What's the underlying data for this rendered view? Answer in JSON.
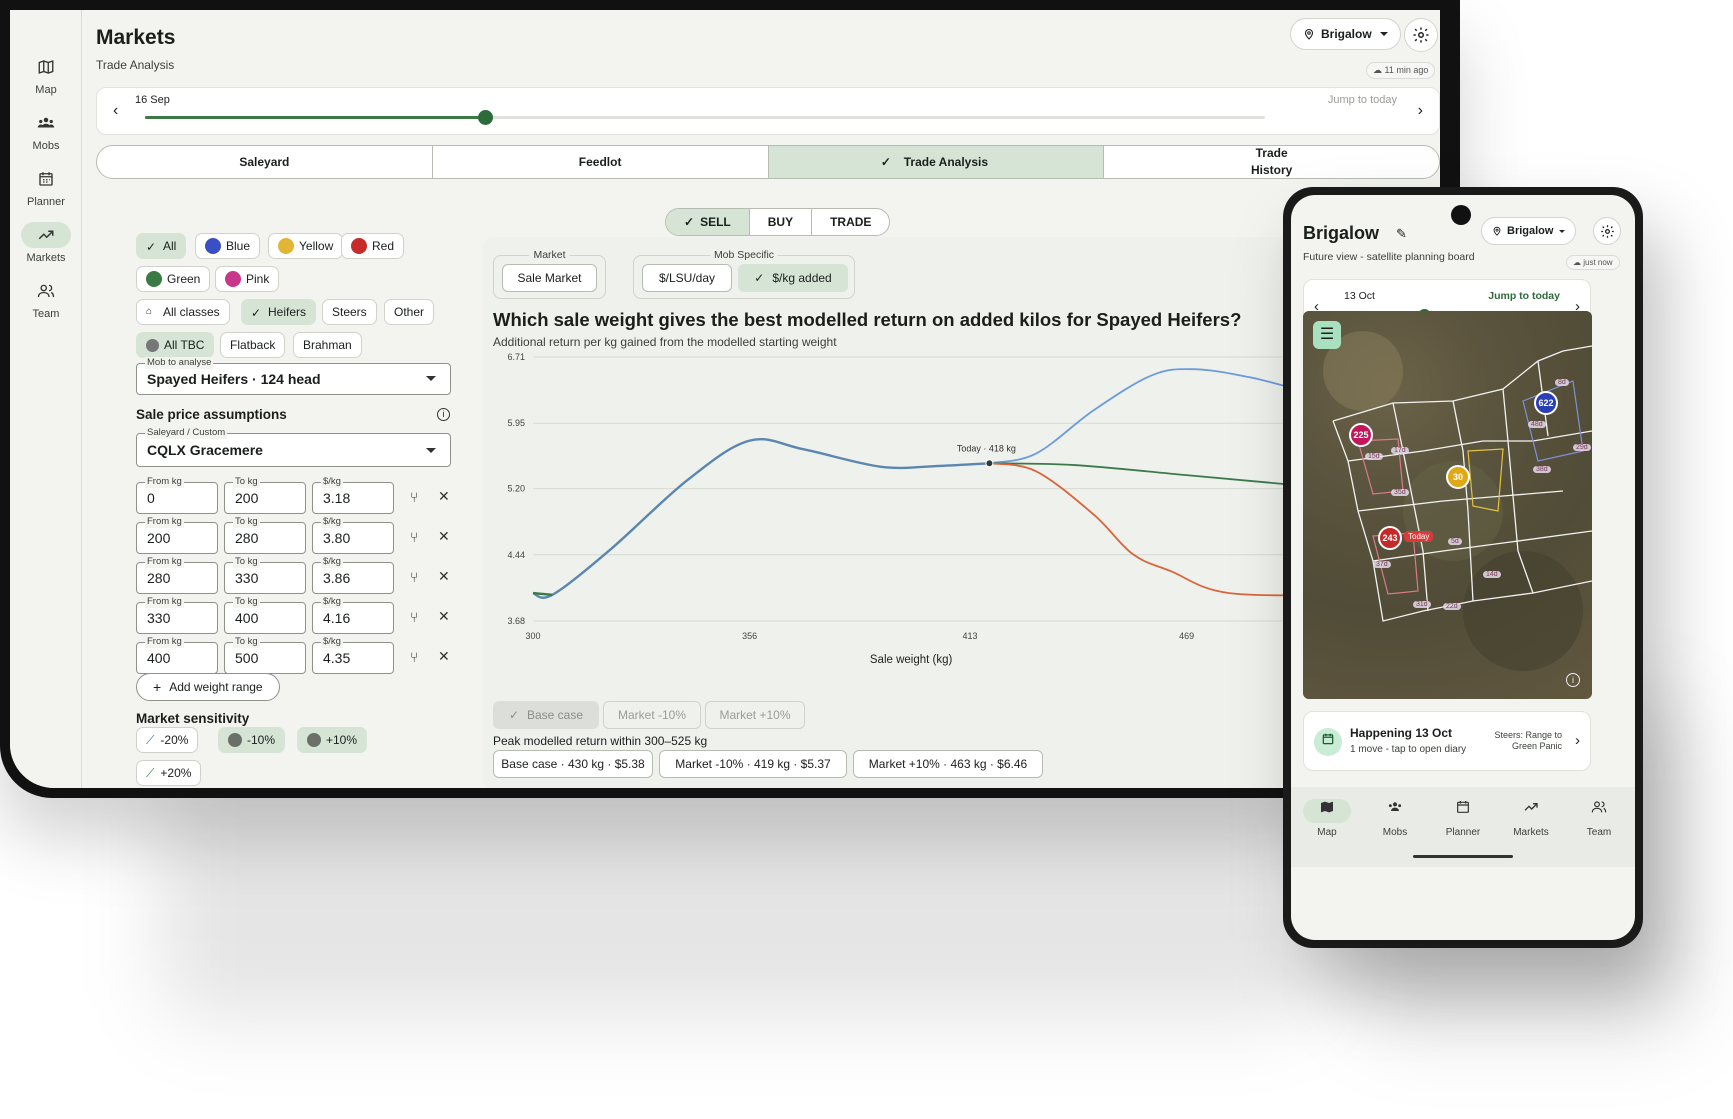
{
  "tablet": {
    "nav_rail": [
      {
        "label": "Map",
        "icon": "map-icon"
      },
      {
        "label": "Mobs",
        "icon": "mobs-icon"
      },
      {
        "label": "Planner",
        "icon": "calendar-icon"
      },
      {
        "label": "Markets",
        "icon": "trending-up-icon",
        "active": true
      },
      {
        "label": "Team",
        "icon": "team-icon"
      }
    ],
    "header": {
      "title": "Markets",
      "subtitle": "Trade Analysis",
      "property": "Brigalow",
      "sync": "11 min ago"
    },
    "timeline": {
      "date": "16 Sep",
      "jump": "Jump to today",
      "position": 0.304
    },
    "tabs": [
      {
        "label": "Saleyard",
        "active": false
      },
      {
        "label": "Feedlot",
        "active": false
      },
      {
        "label": "Trade Analysis",
        "active": true
      },
      {
        "label": "Trade History",
        "active": false
      }
    ],
    "mode": [
      "SELL",
      "BUY",
      "TRADE"
    ],
    "mode_active": "SELL",
    "color_chips": [
      {
        "label": "All",
        "on": true
      },
      {
        "label": "Blue",
        "color": "#3b4fc4"
      },
      {
        "label": "Yellow",
        "color": "#e2b534"
      },
      {
        "label": "Red",
        "color": "#c62a2a"
      },
      {
        "label": "Green",
        "color": "#3c7a45"
      },
      {
        "label": "Pink",
        "color": "#c9378a"
      }
    ],
    "class_chips": [
      {
        "label": "All classes"
      },
      {
        "label": "Heifers",
        "on": true
      },
      {
        "label": "Steers"
      },
      {
        "label": "Other"
      }
    ],
    "breed_chips": [
      {
        "label": "All TBC",
        "on": true
      },
      {
        "label": "Flatback"
      },
      {
        "label": "Brahman"
      }
    ],
    "mob_field": {
      "label": "Mob to analyse",
      "value": "Spayed Heifers · 124 head"
    },
    "sale_price_title": "Sale price assumptions",
    "saleyard_field": {
      "label": "Saleyard / Custom",
      "value": "CQLX Gracemere"
    },
    "range_labels": {
      "from": "From kg",
      "to": "To kg",
      "price": "$/kg"
    },
    "ranges": [
      {
        "from": "0",
        "to": "200",
        "price": "3.18"
      },
      {
        "from": "200",
        "to": "280",
        "price": "3.80"
      },
      {
        "from": "280",
        "to": "330",
        "price": "3.86"
      },
      {
        "from": "330",
        "to": "400",
        "price": "4.16"
      },
      {
        "from": "400",
        "to": "500",
        "price": "4.35"
      }
    ],
    "add_range": "Add weight range",
    "sensitivity_title": "Market sensitivity",
    "sensitivity": [
      {
        "label": "-20%"
      },
      {
        "label": "-10%",
        "on": true
      },
      {
        "label": "+10%",
        "on": true
      },
      {
        "label": "+20%"
      }
    ],
    "market_group": {
      "legend": "Market",
      "button": "Sale Market"
    },
    "mob_specific_group": {
      "legend": "Mob Specific",
      "buttons": [
        "$/LSU/day",
        "$/kg added"
      ]
    },
    "chart_title": "Which sale weight gives the best modelled return on added kilos for Spayed Heifers?",
    "chart_subtitle": "Additional return per kg gained from the modelled starting weight",
    "today_label": "Today · 418 kg",
    "legend_buttons": [
      "Base case",
      "Market -10%",
      "Market +10%"
    ],
    "peak_text": "Peak modelled return within 300–525 kg",
    "peak_chips": [
      "Base case · 430 kg · $5.38",
      "Market -10% · 419 kg · $5.37",
      "Market +10% · 463 kg · $6.46"
    ]
  },
  "chart_data": {
    "type": "line",
    "title": "Which sale weight gives the best modelled return on added kilos for Spayed Heifers?",
    "subtitle": "Additional return per kg gained from the modelled starting weight",
    "xlabel": "Sale weight (kg)",
    "ylabel": "",
    "xlim": [
      300,
      512
    ],
    "ylim": [
      3.68,
      6.71
    ],
    "x_ticks": [
      "300",
      "356",
      "413",
      "469"
    ],
    "y_ticks": [
      "6.71",
      "5.95",
      "5.20",
      "4.44",
      "3.68"
    ],
    "grid": true,
    "series": [
      {
        "name": "Base case",
        "color": "#5b86b0",
        "x": [
          300,
          305,
          320,
          340,
          356,
          370,
          390,
          405,
          418
        ],
        "y": [
          4.0,
          3.98,
          4.5,
          5.3,
          5.75,
          5.65,
          5.45,
          5.46,
          5.49
        ]
      },
      {
        "name": "Market +10%",
        "color": "#6c9be0",
        "x": [
          418,
          430,
          445,
          460,
          471,
          485,
          500,
          512
        ],
        "y": [
          5.49,
          5.6,
          6.1,
          6.5,
          6.57,
          6.48,
          6.32,
          6.25
        ]
      },
      {
        "name": "Market -10%",
        "color": "#3d7a4b",
        "x": [
          418,
          440,
          470,
          512
        ],
        "y": [
          5.49,
          5.47,
          5.35,
          5.18
        ]
      },
      {
        "name": "Market -20%",
        "color": "#d9653a",
        "x": [
          418,
          430,
          445,
          455,
          465,
          480,
          512
        ],
        "y": [
          5.49,
          5.4,
          4.9,
          4.45,
          4.25,
          4.0,
          3.98
        ]
      }
    ],
    "marker": {
      "x": 418,
      "y": 5.49,
      "label": "Today · 418 kg"
    }
  },
  "phone": {
    "title": "Brigalow",
    "subtitle": "Future view - satellite planning board",
    "property": "Brigalow",
    "sync": "just now",
    "timeline": {
      "date": "13 Oct",
      "jump": "Jump to today",
      "position": 0.37
    },
    "map_badges": [
      {
        "label": "225",
        "color": "#c2185b"
      },
      {
        "label": "622",
        "color": "#2a3fb5"
      },
      {
        "label": "30",
        "color": "#e0a817"
      },
      {
        "label": "243",
        "color": "#c62828"
      }
    ],
    "map_today": "Today",
    "map_day_labels": [
      "8d",
      "48d",
      "29d",
      "38d",
      "17d",
      "15d",
      "35d",
      "5d",
      "37d",
      "14d",
      "31d",
      "22d"
    ],
    "happening": {
      "title": "Happening 13 Oct",
      "sub": "1 move - tap to open diary",
      "detail": "Steers: Range to Green Panic"
    },
    "bottom_nav": [
      {
        "label": "Map",
        "icon": "map-icon",
        "active": true
      },
      {
        "label": "Mobs",
        "icon": "mobs-icon"
      },
      {
        "label": "Planner",
        "icon": "calendar-icon"
      },
      {
        "label": "Markets",
        "icon": "trending-up-icon"
      },
      {
        "label": "Team",
        "icon": "team-icon"
      }
    ]
  }
}
